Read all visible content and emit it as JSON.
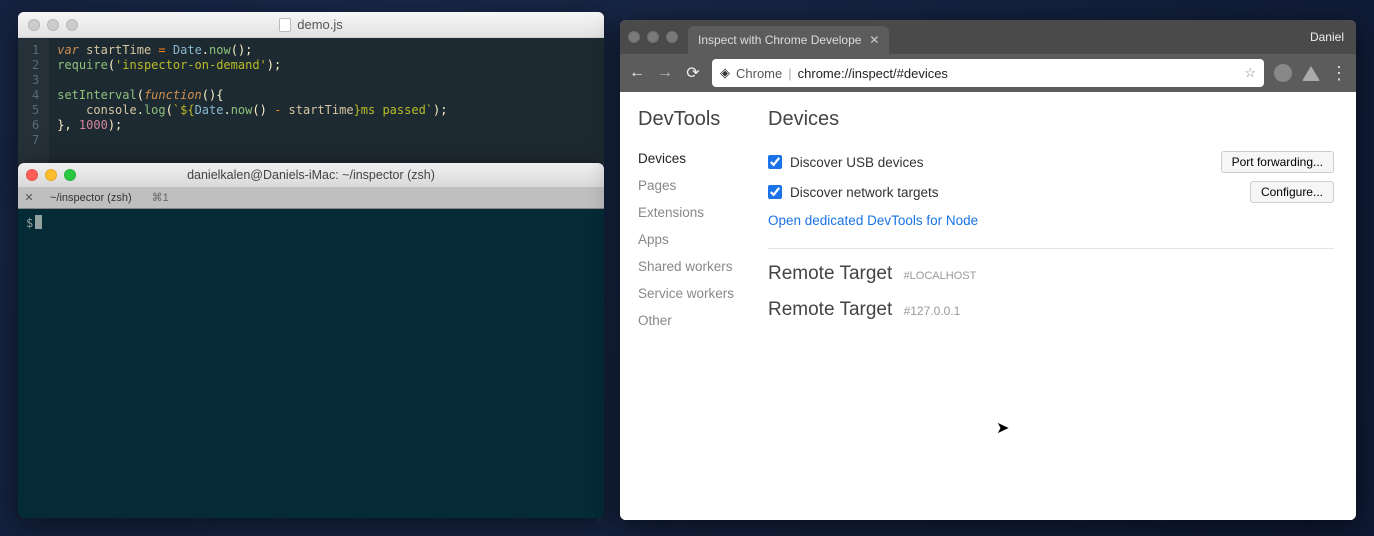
{
  "editor": {
    "filename": "demo.js",
    "lines": [
      "1",
      "2",
      "3",
      "4",
      "5",
      "6",
      "7"
    ],
    "code": {
      "l1_var": "var",
      "l1_id": "startTime",
      "l1_eq": "=",
      "l1_cls": "Date",
      "l1_dot": ".",
      "l1_fn": "now",
      "l1_p": "();",
      "l2_fn": "require",
      "l2_p1": "(",
      "l2_str": "'inspector-on-demand'",
      "l2_p2": ");",
      "l4_fn": "setInterval",
      "l4_p1": "(",
      "l4_kw": "function",
      "l4_p2": "(){",
      "l5_obj": "console",
      "l5_dot": ".",
      "l5_fn": "log",
      "l5_p1": "(",
      "l5_str1": "`${",
      "l5_cls": "Date",
      "l5_d2": ".",
      "l5_fn2": "now",
      "l5_p2": "()",
      "l5_op": " - ",
      "l5_id": "startTime",
      "l5_str2": "}ms passed`",
      "l5_p3": ");",
      "l6_p": "}, ",
      "l6_num": "1000",
      "l6_p2": ");"
    }
  },
  "terminal": {
    "title": "danielkalen@Daniels-iMac: ~/inspector (zsh)",
    "tab_close": "✕",
    "tab_label": "~/inspector (zsh)",
    "tab_kbd": "⌘1",
    "prompt": "$"
  },
  "chrome": {
    "tab_title": "Inspect with Chrome Develope",
    "user": "Daniel",
    "omnibox_label": "Chrome",
    "omnibox_url": "chrome://inspect/#devices",
    "sidebar_title": "DevTools",
    "sidebar_items": [
      {
        "label": "Devices",
        "active": true
      },
      {
        "label": "Pages",
        "active": false
      },
      {
        "label": "Extensions",
        "active": false
      },
      {
        "label": "Apps",
        "active": false
      },
      {
        "label": "Shared workers",
        "active": false
      },
      {
        "label": "Service workers",
        "active": false
      },
      {
        "label": "Other",
        "active": false
      }
    ],
    "main_title": "Devices",
    "check_usb": "Discover USB devices",
    "btn_portfwd": "Port forwarding...",
    "check_net": "Discover network targets",
    "btn_configure": "Configure...",
    "link_node": "Open dedicated DevTools for Node",
    "target1_label": "Remote Target",
    "target1_host": "#localhost",
    "target2_label": "Remote Target",
    "target2_host": "#127.0.0.1"
  }
}
